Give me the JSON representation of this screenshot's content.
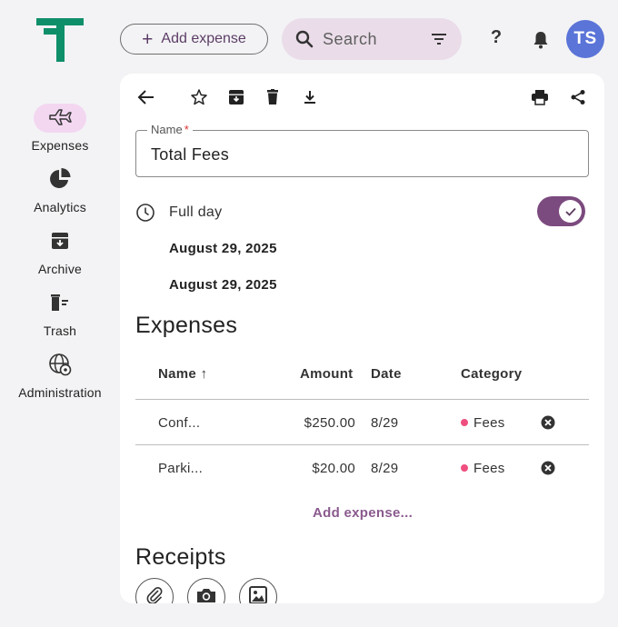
{
  "header": {
    "add_expense_label": "Add expense",
    "search_placeholder": "Search",
    "help_label": "?",
    "avatar_initials": "TS",
    "avatar_color": "#5b74d8",
    "brand_color": "#0e8f6a"
  },
  "sidebar": {
    "items": [
      {
        "label": "Expenses",
        "icon": "airplane-icon",
        "active": true
      },
      {
        "label": "Analytics",
        "icon": "pie-chart-icon",
        "active": false
      },
      {
        "label": "Archive",
        "icon": "archive-icon",
        "active": false
      },
      {
        "label": "Trash",
        "icon": "trash-list-icon",
        "active": false
      },
      {
        "label": "Administration",
        "icon": "globe-gear-icon",
        "active": false
      }
    ]
  },
  "toolbar": {
    "icons": [
      "back-arrow-icon",
      "star-icon",
      "archive-icon",
      "trash-icon",
      "download-icon",
      "print-icon",
      "share-icon"
    ]
  },
  "form": {
    "name_label": "Name",
    "name_required_mark": "*",
    "name_value": "Total Fees",
    "full_day_label": "Full day",
    "full_day_checked": true,
    "start_date": "August 29, 2025",
    "end_date": "August 29, 2025"
  },
  "expenses": {
    "title": "Expenses",
    "columns": {
      "name": "Name",
      "sort_indicator": "↑",
      "amount": "Amount",
      "date": "Date",
      "category": "Category"
    },
    "rows": [
      {
        "name": "Conf...",
        "amount": "$250.00",
        "date": "8/29",
        "category": "Fees"
      },
      {
        "name": "Parki...",
        "amount": "$20.00",
        "date": "8/29",
        "category": "Fees"
      }
    ],
    "add_link": "Add expense..."
  },
  "receipts": {
    "title": "Receipts",
    "buttons": [
      "paperclip-icon",
      "camera-icon",
      "image-icon"
    ]
  },
  "colors": {
    "accent": "#7b4a7e",
    "search_bg": "#eadde9",
    "nav_active_bg": "#f3d7f1",
    "fees_dot": "#ef4f7f"
  }
}
